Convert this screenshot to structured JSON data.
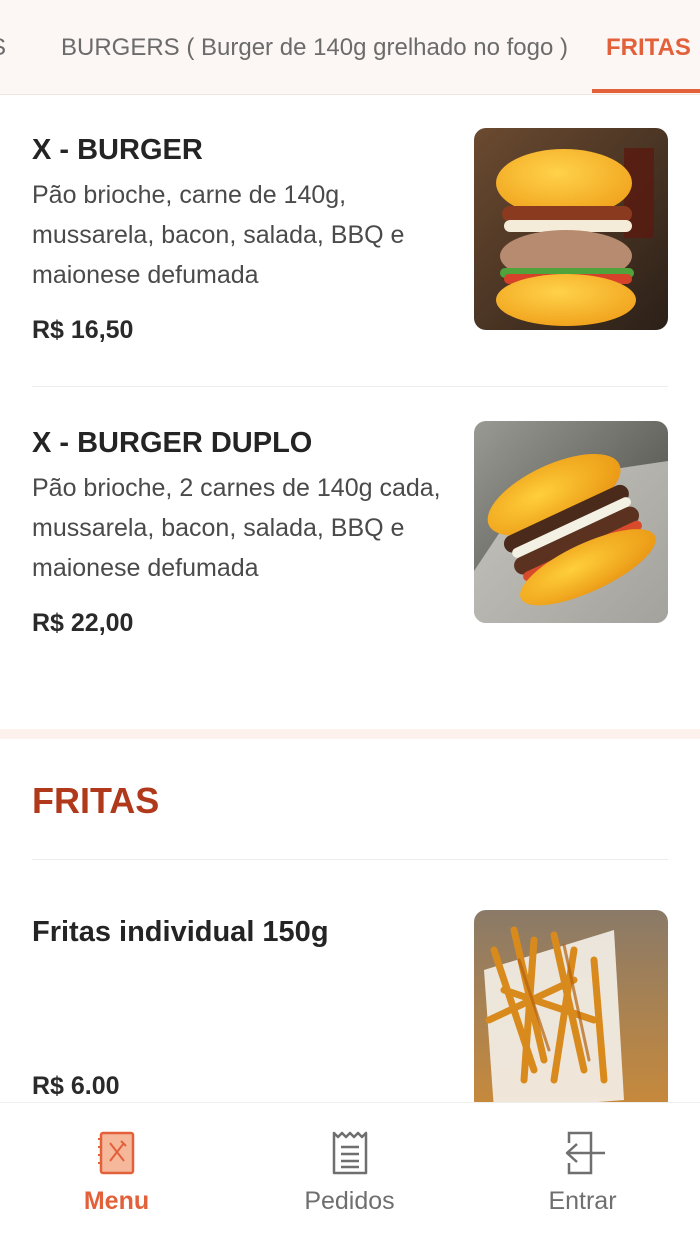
{
  "tabs": {
    "prev_partial": "S",
    "burgers": "BURGERS ( Burger de 140g grelhado no fogo )",
    "fritas": "FRITAS"
  },
  "items": [
    {
      "name": "X - BURGER",
      "description": "Pão brioche, carne de 140g, mussarela, bacon, salada, BBQ e maionese defumada",
      "price": "R$ 16,50"
    },
    {
      "name": "X - BURGER DUPLO",
      "description": "Pão brioche, 2 carnes de 140g cada, mussarela, bacon, salada, BBQ e maionese defumada",
      "price": "R$ 22,00"
    }
  ],
  "fritas_section": {
    "title": "FRITAS",
    "items": [
      {
        "name": "Fritas individual 150g",
        "price": "R$ 6.00"
      }
    ]
  },
  "bottom_nav": [
    {
      "label": "Menu",
      "icon": "menu-book-icon",
      "active": true
    },
    {
      "label": "Pedidos",
      "icon": "receipt-icon",
      "active": false
    },
    {
      "label": "Entrar",
      "icon": "login-icon",
      "active": false
    }
  ],
  "colors": {
    "accent": "#e2603a",
    "section_title": "#b0391b",
    "tab_bar_bg": "#fcf7f4"
  }
}
